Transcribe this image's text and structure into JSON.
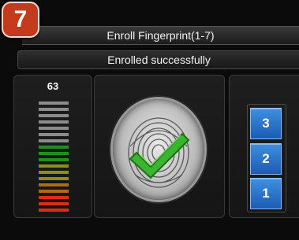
{
  "badge": {
    "number": "7"
  },
  "title": "Enroll Fingerprint(1-7)",
  "status": "Enrolled successfully",
  "quality": {
    "value": "63",
    "bar_colors": [
      "#8c8c8c",
      "#8c8c8c",
      "#8c8c8c",
      "#8c8c8c",
      "#8c8c8c",
      "#8c8c8c",
      "#8c8c8c",
      "#1f8f1f",
      "#1f8f1f",
      "#1f8f1f",
      "#8a8f1a",
      "#8a8f1a",
      "#8a8f1a",
      "#b06a1a",
      "#b06a1a",
      "#e02a1a",
      "#e02a1a",
      "#e02a1a"
    ]
  },
  "scanner": {
    "icon": "fingerprint-success-icon",
    "check_color": "#39b52e"
  },
  "steps": [
    "3",
    "2",
    "1"
  ],
  "colors": {
    "badge": "#c43a1c",
    "step_blue": "#2a74cf"
  }
}
